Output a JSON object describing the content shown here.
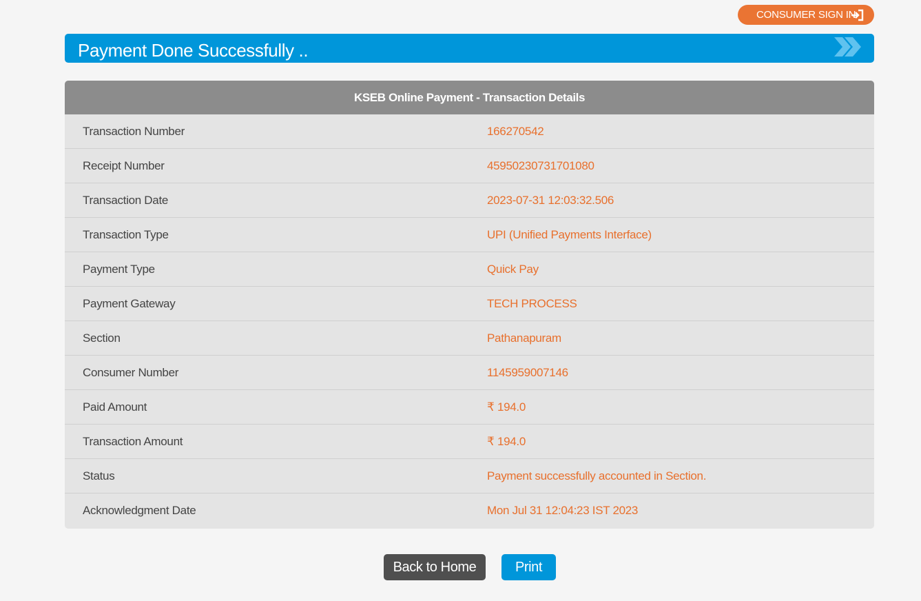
{
  "header": {
    "signin_label": "CONSUMER SIGN IN",
    "signin_icon": "sign-in-icon"
  },
  "banner": {
    "title": "Payment Done Successfully ..",
    "icon": "double-chevron-right-icon"
  },
  "details": {
    "title": "KSEB Online Payment - Transaction Details",
    "rows": [
      {
        "label": "Transaction Number",
        "value": "166270542"
      },
      {
        "label": "Receipt Number",
        "value": "45950230731701080"
      },
      {
        "label": "Transaction Date",
        "value": "2023-07-31 12:03:32.506"
      },
      {
        "label": "Transaction Type",
        "value": "UPI (Unified Payments Interface)"
      },
      {
        "label": "Payment Type",
        "value": "Quick Pay"
      },
      {
        "label": "Payment Gateway",
        "value": "TECH PROCESS"
      },
      {
        "label": "Section",
        "value": "Pathanapuram"
      },
      {
        "label": "Consumer Number",
        "value": "1145959007146"
      },
      {
        "label": "Paid Amount",
        "value": "₹ 194.0"
      },
      {
        "label": "Transaction Amount",
        "value": "₹ 194.0"
      },
      {
        "label": "Status",
        "value": "Payment successfully accounted in Section."
      },
      {
        "label": "Acknowledgment Date",
        "value": "Mon Jul 31 12:04:23 IST 2023"
      }
    ]
  },
  "actions": {
    "home_label": "Back to Home",
    "print_label": "Print"
  },
  "colors": {
    "accent_orange": "#ea7433",
    "accent_blue": "#0096da",
    "header_gray": "#8c8c8c",
    "row_bg": "#e4e4e4",
    "value_text": "#e8702d",
    "home_button": "#4f4f4f"
  }
}
